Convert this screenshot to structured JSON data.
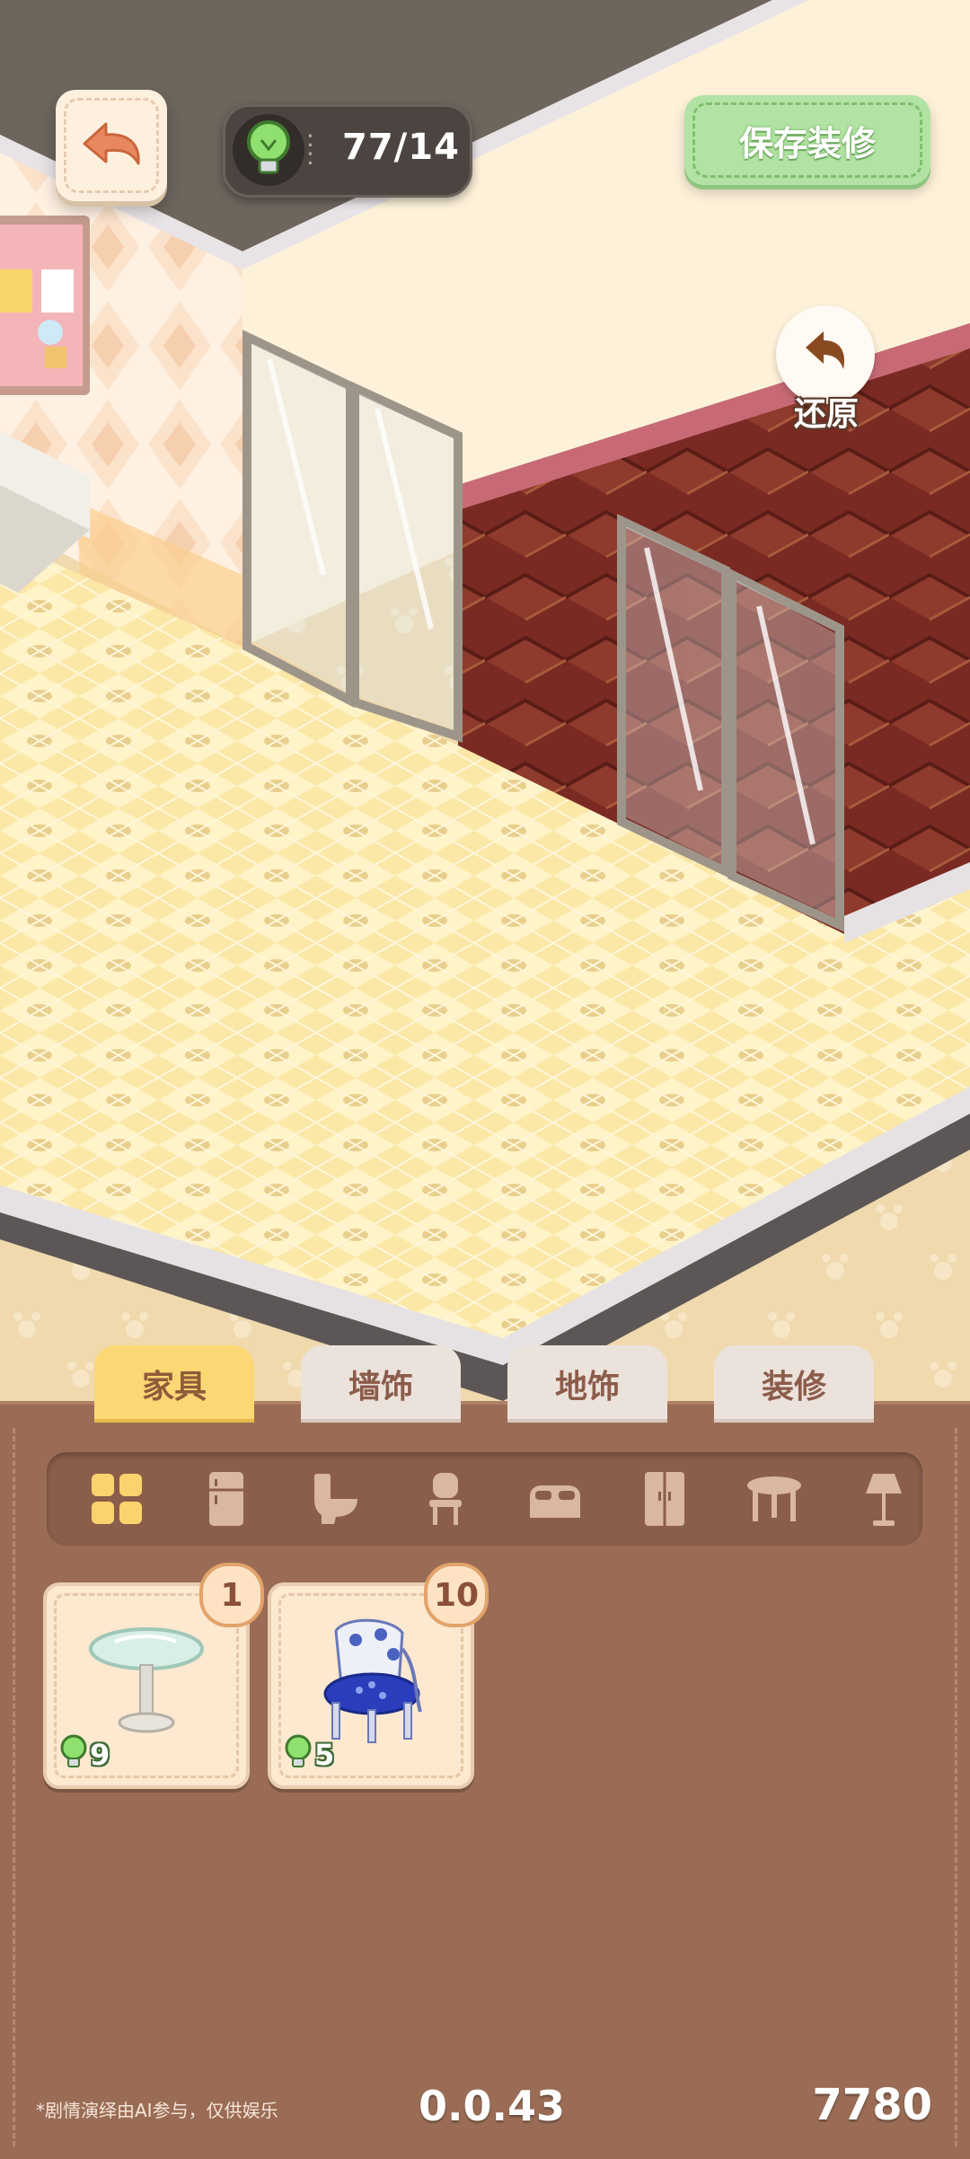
{
  "header": {
    "energy": "77/14",
    "save_label": "保存装修",
    "restore_label": "还原"
  },
  "tabs": [
    {
      "label": "家具",
      "active": true
    },
    {
      "label": "墙饰",
      "active": false
    },
    {
      "label": "地饰",
      "active": false
    },
    {
      "label": "装修",
      "active": false
    }
  ],
  "categories": [
    "all-icon",
    "fridge-icon",
    "toilet-icon",
    "chair-icon",
    "bed-icon",
    "wardrobe-icon",
    "table-icon",
    "lamp-icon"
  ],
  "items": [
    {
      "name": "glass-round-table",
      "count": "1",
      "cost": "9"
    },
    {
      "name": "blue-floral-chair",
      "count": "10",
      "cost": "5"
    }
  ],
  "footer": {
    "note": "*剧情演绎由AI参与，仅供娱乐",
    "version": "0.0.43",
    "score": "7780"
  },
  "colors": {
    "panel": "#9a6c55",
    "accent_tab": "#fbd874",
    "save_green": "#b2e3a4",
    "floor": "#fbe7a6"
  }
}
